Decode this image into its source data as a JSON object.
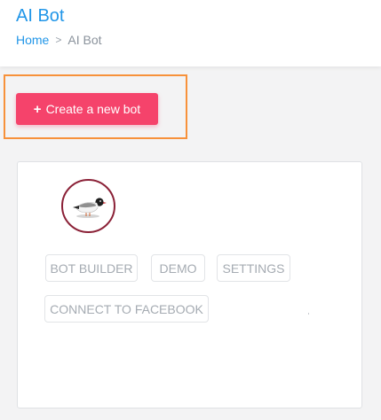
{
  "header": {
    "title": "AI Bot",
    "breadcrumb": {
      "home": "Home",
      "separator": ">",
      "current": "AI Bot"
    }
  },
  "actions": {
    "create_bot_icon": "plus-icon",
    "create_bot_label": "Create a new bot"
  },
  "bot_card": {
    "avatar_icon": "seagull-bird-logo",
    "buttons": {
      "bot_builder": "BOT BUILDER",
      "demo": "DEMO",
      "settings": "SETTINGS",
      "connect_facebook": "CONNECT TO FACEBOOK"
    }
  },
  "colors": {
    "title_blue": "#2196e8",
    "create_button": "#f5436b",
    "highlight_border": "#f7913a",
    "avatar_ring": "#8b2137"
  }
}
